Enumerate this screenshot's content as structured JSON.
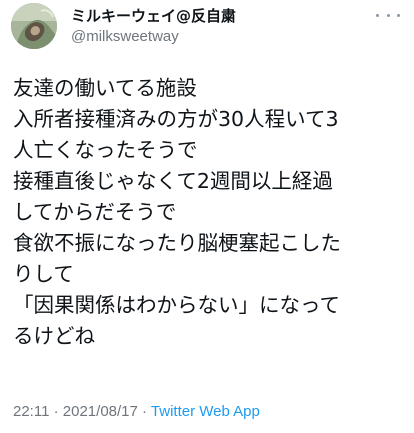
{
  "tweet": {
    "display_name": "ミルキーウェイ@反自粛",
    "handle": "@milksweetway",
    "more_icon": "ellipsis-icon",
    "avatar_icon": "avatar-photo",
    "lines": [
      "友達の働いてる施設",
      "入所者接種済みの方が30人程いて3",
      "人亡くなったそうで",
      "接種直後じゃなくて2週間以上経過",
      "してからだそうで",
      "食欲不振になったり脳梗塞起こした",
      "りして",
      "「因果関係はわからない」になって",
      "るけどね"
    ],
    "time": "22:11",
    "separator": " · ",
    "date": "2021/08/17",
    "source": "Twitter Web App",
    "colors": {
      "text": "#0f1419",
      "muted": "#6e767d",
      "link": "#1d9bf0"
    }
  }
}
